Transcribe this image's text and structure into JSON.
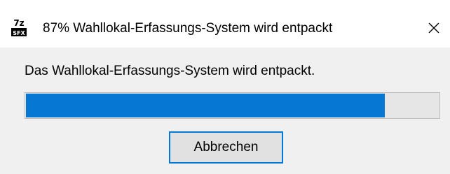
{
  "window": {
    "title": "87% Wahllokal-Erfassungs-System wird entpackt",
    "icon": "7z-sfx-icon",
    "close_symbol": "close-icon"
  },
  "body": {
    "message": "Das Wahllokal-Erfassungs-System wird entpackt.",
    "progress_percent": 87,
    "cancel_label": "Abbrechen"
  },
  "colors": {
    "progress_fill": "#0678d4",
    "button_focus_border": "#0078d7",
    "client_background": "#f0f0f0"
  }
}
